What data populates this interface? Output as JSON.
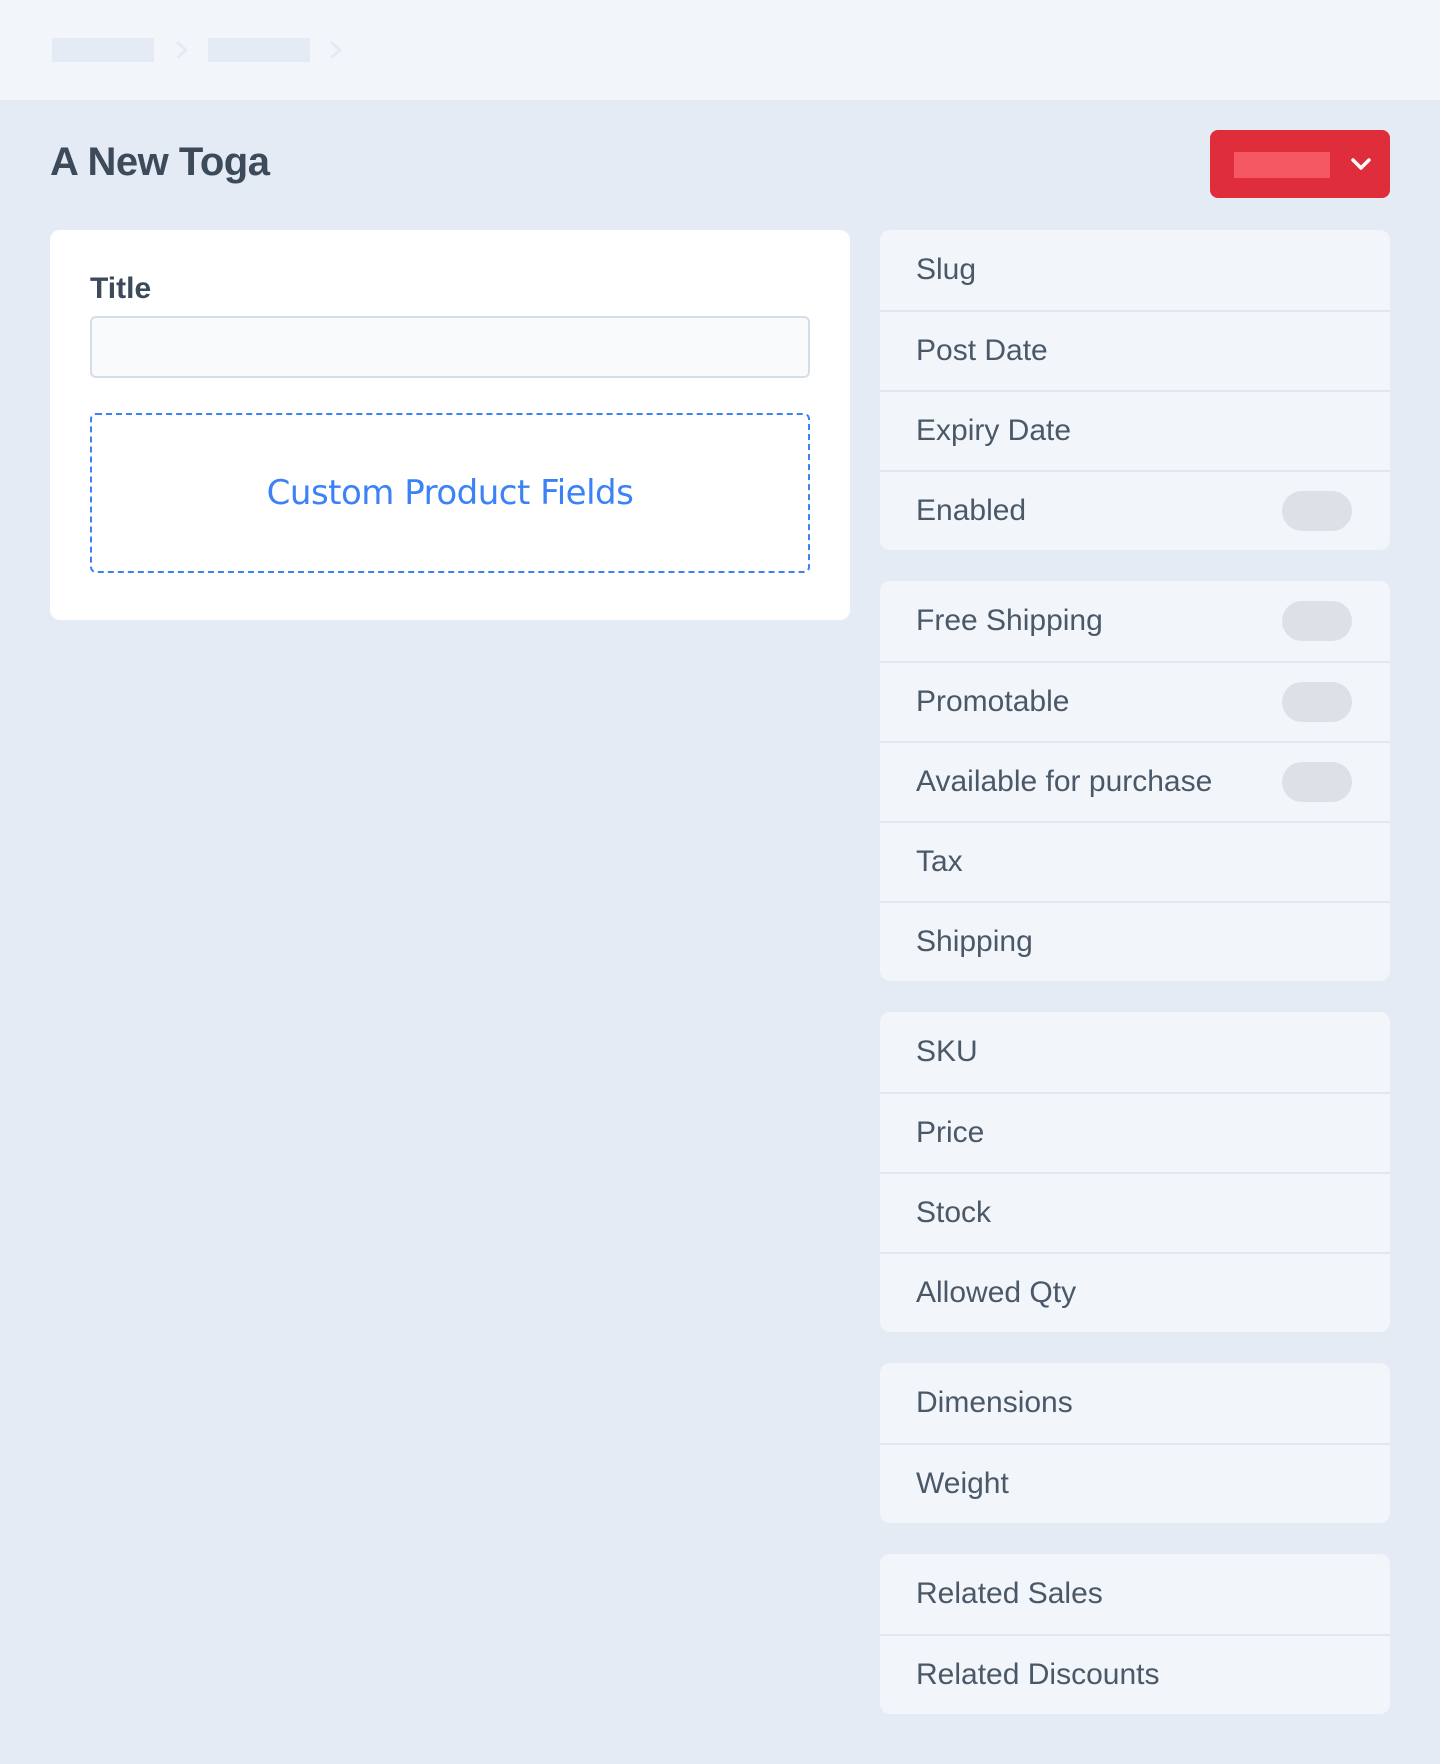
{
  "breadcrumb": {
    "items": [
      {
        "label": "",
        "placeholder": true
      },
      {
        "label": "",
        "placeholder": true
      }
    ],
    "separator_icon": "chevron-right-icon"
  },
  "page": {
    "title": "A New Toga"
  },
  "actions": {
    "primary_button_label": "",
    "primary_button_icon": "chevron-down-icon",
    "primary_color": "#e02d3c"
  },
  "main": {
    "title_field": {
      "label": "Title",
      "value": "",
      "placeholder": ""
    },
    "custom_fields_label": "Custom Product Fields",
    "accent_color": "#3b82f6"
  },
  "sidebar": {
    "panels": [
      {
        "rows": [
          {
            "label": "Slug",
            "toggle": false
          },
          {
            "label": "Post Date",
            "toggle": false
          },
          {
            "label": "Expiry Date",
            "toggle": false
          },
          {
            "label": "Enabled",
            "toggle": true,
            "on": false
          }
        ]
      },
      {
        "rows": [
          {
            "label": "Free Shipping",
            "toggle": true,
            "on": false
          },
          {
            "label": "Promotable",
            "toggle": true,
            "on": false
          },
          {
            "label": "Available for purchase",
            "toggle": true,
            "on": false
          },
          {
            "label": "Tax",
            "toggle": false
          },
          {
            "label": "Shipping",
            "toggle": false
          }
        ]
      },
      {
        "rows": [
          {
            "label": "SKU",
            "toggle": false
          },
          {
            "label": "Price",
            "toggle": false
          },
          {
            "label": "Stock",
            "toggle": false
          },
          {
            "label": "Allowed Qty",
            "toggle": false
          }
        ]
      },
      {
        "rows": [
          {
            "label": "Dimensions",
            "toggle": false
          },
          {
            "label": "Weight",
            "toggle": false
          }
        ]
      },
      {
        "rows": [
          {
            "label": "Related Sales",
            "toggle": false
          },
          {
            "label": "Related Discounts",
            "toggle": false
          }
        ]
      }
    ]
  }
}
